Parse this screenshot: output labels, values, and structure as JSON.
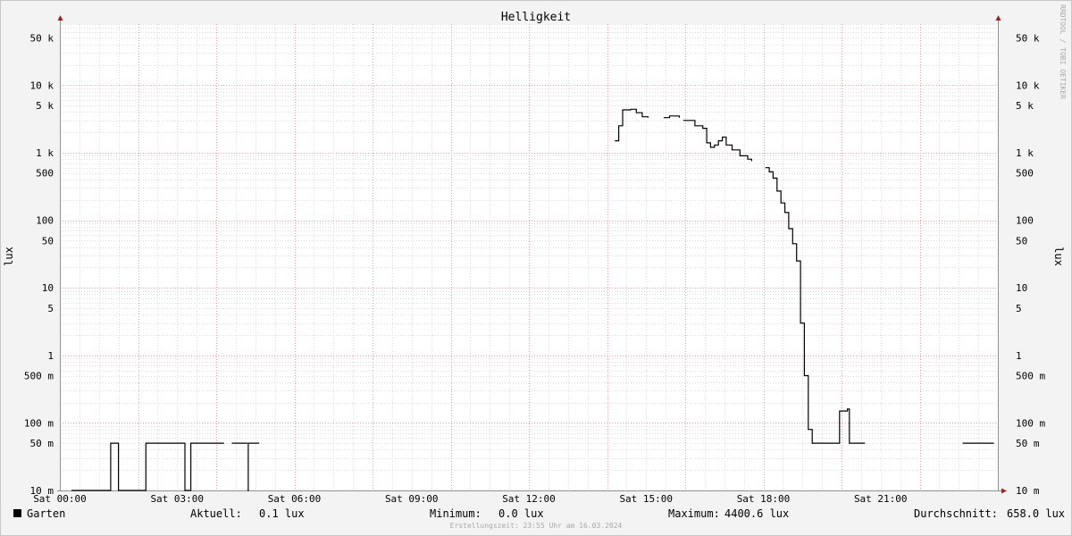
{
  "chart_data": {
    "type": "line",
    "title": "Helligkeit",
    "ylabel": "lux",
    "yscale": "log",
    "ylim": [
      0.01,
      80000
    ],
    "xlim": [
      0,
      24
    ],
    "x_ticks": [
      {
        "x": 0,
        "label": "Sat 00:00"
      },
      {
        "x": 3,
        "label": "Sat 03:00"
      },
      {
        "x": 6,
        "label": "Sat 06:00"
      },
      {
        "x": 9,
        "label": "Sat 09:00"
      },
      {
        "x": 12,
        "label": "Sat 12:00"
      },
      {
        "x": 15,
        "label": "Sat 15:00"
      },
      {
        "x": 18,
        "label": "Sat 18:00"
      },
      {
        "x": 21,
        "label": "Sat 21:00"
      }
    ],
    "y_ticks": [
      {
        "v": 50000,
        "label": "50 k"
      },
      {
        "v": 10000,
        "label": "10 k"
      },
      {
        "v": 5000,
        "label": "5 k"
      },
      {
        "v": 1000,
        "label": "1 k"
      },
      {
        "v": 500,
        "label": "500"
      },
      {
        "v": 100,
        "label": "100"
      },
      {
        "v": 50,
        "label": "50"
      },
      {
        "v": 10,
        "label": "10"
      },
      {
        "v": 5,
        "label": "5"
      },
      {
        "v": 1,
        "label": "1"
      },
      {
        "v": 0.5,
        "label": "500 m"
      },
      {
        "v": 0.1,
        "label": "100 m"
      },
      {
        "v": 0.05,
        "label": "50 m"
      },
      {
        "v": 0.01,
        "label": "10 m"
      }
    ],
    "grid": true,
    "series": [
      {
        "name": "Garten",
        "color": "#000000",
        "segments": [
          [
            [
              0.3,
              0.01
            ],
            [
              1.0,
              0.01
            ],
            [
              1.3,
              0.01
            ],
            [
              1.3,
              0.05
            ],
            [
              1.5,
              0.05
            ],
            [
              1.5,
              0.01
            ],
            [
              2.2,
              0.01
            ],
            [
              2.2,
              0.05
            ],
            [
              3.2,
              0.05
            ],
            [
              3.2,
              0.01
            ],
            [
              3.35,
              0.01
            ],
            [
              3.35,
              0.05
            ],
            [
              4.2,
              0.05
            ]
          ],
          [
            [
              4.4,
              0.05
            ],
            [
              4.8,
              0.05
            ]
          ],
          [
            [
              4.8,
              0.01
            ],
            [
              4.82,
              0.05
            ],
            [
              4.95,
              0.05
            ],
            [
              5.0,
              0.05
            ],
            [
              5.1,
              0.05
            ]
          ],
          [
            [
              14.2,
              1500
            ],
            [
              14.3,
              2500
            ],
            [
              14.4,
              4300
            ],
            [
              14.6,
              4400
            ],
            [
              14.75,
              3900
            ],
            [
              14.9,
              3400
            ],
            [
              15.05,
              3300
            ]
          ],
          [
            [
              15.45,
              3300
            ],
            [
              15.6,
              3500
            ],
            [
              15.85,
              3300
            ]
          ],
          [
            [
              15.95,
              3000
            ],
            [
              16.15,
              3000
            ],
            [
              16.25,
              2500
            ],
            [
              16.45,
              2300
            ],
            [
              16.55,
              1400
            ],
            [
              16.65,
              1200
            ],
            [
              16.75,
              1300
            ],
            [
              16.85,
              1500
            ],
            [
              16.95,
              1700
            ],
            [
              17.05,
              1300
            ],
            [
              17.2,
              1100
            ],
            [
              17.4,
              900
            ],
            [
              17.6,
              800
            ],
            [
              17.7,
              750
            ]
          ],
          [
            [
              18.05,
              600
            ],
            [
              18.15,
              520
            ],
            [
              18.25,
              420
            ],
            [
              18.35,
              270
            ],
            [
              18.45,
              180
            ],
            [
              18.55,
              130
            ],
            [
              18.65,
              75
            ],
            [
              18.75,
              45
            ],
            [
              18.85,
              25
            ],
            [
              18.95,
              3
            ],
            [
              19.05,
              0.5
            ],
            [
              19.15,
              0.08
            ],
            [
              19.25,
              0.05
            ],
            [
              19.5,
              0.05
            ],
            [
              19.9,
              0.05
            ],
            [
              19.95,
              0.15
            ],
            [
              20.15,
              0.16
            ],
            [
              20.2,
              0.05
            ],
            [
              20.6,
              0.05
            ]
          ],
          [
            [
              23.1,
              0.05
            ],
            [
              23.9,
              0.05
            ]
          ]
        ]
      }
    ]
  },
  "footer": {
    "legend_label": "Garten",
    "legend_color": "#000000",
    "current_label": "Aktuell:",
    "current_value": "0.1 lux",
    "min_label": "Minimum:",
    "min_value": "0.0 lux",
    "max_label": "Maximum:",
    "max_value": "4400.6 lux",
    "avg_label": "Durchschnitt:",
    "avg_value": "658.0 lux",
    "created": "Erstellungszeit: 23:55 Uhr am 16.03.2024"
  },
  "watermark": "RRDTOOL / TOBI OETIKER",
  "colors": {
    "background": "#f3f3f3",
    "plot_background": "#ffffff",
    "major_grid": "#e8a0a0",
    "minor_grid": "#dcdcdc",
    "axis": "#909090",
    "arrow": "#a02020"
  }
}
